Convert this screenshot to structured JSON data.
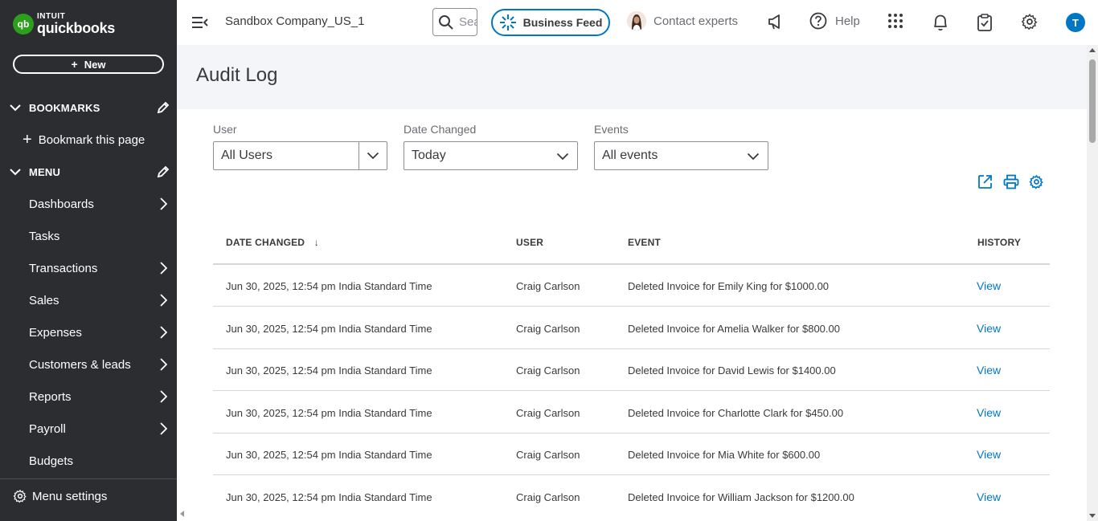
{
  "app": {
    "logo_line1": "INTUIT",
    "logo_line2": "quickbooks",
    "logo_mark": "qb"
  },
  "sidebar": {
    "new_label": "New",
    "bookmarks_label": "BOOKMARKS",
    "bookmark_page_label": "Bookmark this page",
    "menu_label": "MENU",
    "items": [
      {
        "label": "Dashboards",
        "has_arrow": true
      },
      {
        "label": "Tasks",
        "has_arrow": false
      },
      {
        "label": "Transactions",
        "has_arrow": true
      },
      {
        "label": "Sales",
        "has_arrow": true
      },
      {
        "label": "Expenses",
        "has_arrow": true
      },
      {
        "label": "Customers & leads",
        "has_arrow": true
      },
      {
        "label": "Reports",
        "has_arrow": true
      },
      {
        "label": "Payroll",
        "has_arrow": true
      },
      {
        "label": "Budgets",
        "has_arrow": false
      }
    ],
    "menu_settings_label": "Menu settings"
  },
  "header": {
    "company_name": "Sandbox Company_US_1",
    "search_placeholder": "Search",
    "business_feed_label": "Business Feed",
    "contact_label": "Contact experts",
    "help_label": "Help",
    "user_initial": "T"
  },
  "page": {
    "title": "Audit Log"
  },
  "filters": {
    "user": {
      "label": "User",
      "value": "All Users"
    },
    "date_changed": {
      "label": "Date Changed",
      "value": "Today"
    },
    "events": {
      "label": "Events",
      "value": "All events"
    }
  },
  "table": {
    "columns": {
      "date_changed": "DATE CHANGED",
      "sort_indicator": "↓",
      "user": "USER",
      "event": "EVENT",
      "history": "HISTORY"
    },
    "rows": [
      {
        "date": "Jun 30, 2025, 12:54 pm India Standard Time",
        "user": "Craig Carlson",
        "event": "Deleted Invoice for Emily King for $1000.00",
        "history": "View"
      },
      {
        "date": "Jun 30, 2025, 12:54 pm India Standard Time",
        "user": "Craig Carlson",
        "event": "Deleted Invoice for Amelia Walker for $800.00",
        "history": "View"
      },
      {
        "date": "Jun 30, 2025, 12:54 pm India Standard Time",
        "user": "Craig Carlson",
        "event": "Deleted Invoice for David Lewis for $1400.00",
        "history": "View"
      },
      {
        "date": "Jun 30, 2025, 12:54 pm India Standard Time",
        "user": "Craig Carlson",
        "event": "Deleted Invoice for Charlotte Clark for $450.00",
        "history": "View"
      },
      {
        "date": "Jun 30, 2025, 12:54 pm India Standard Time",
        "user": "Craig Carlson",
        "event": "Deleted Invoice for Mia White for $600.00",
        "history": "View"
      },
      {
        "date": "Jun 30, 2025, 12:54 pm India Standard Time",
        "user": "Craig Carlson",
        "event": "Deleted Invoice for William Jackson for $1200.00",
        "history": "View"
      }
    ]
  },
  "colors": {
    "sidebar_bg": "#2b2d30",
    "brand_green": "#2ca01c",
    "accent_blue": "#0077c5",
    "page_header_bg": "#f4f5f8"
  }
}
